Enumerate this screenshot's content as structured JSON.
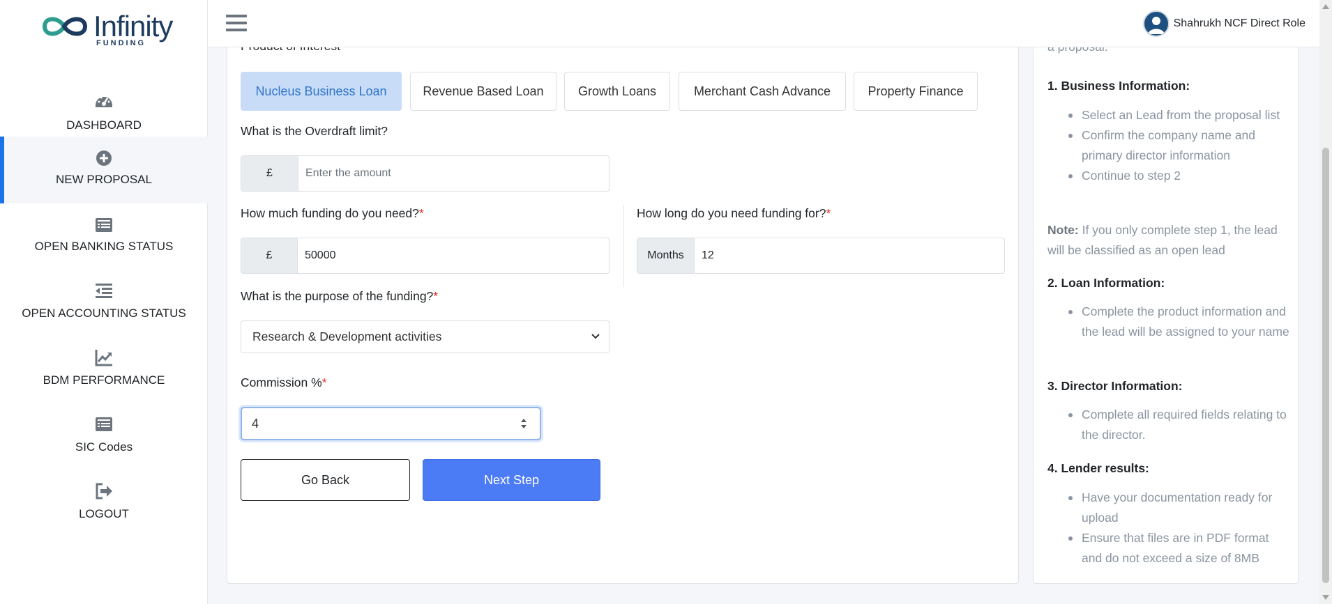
{
  "brand": {
    "name": "Infinity",
    "sub": "FUNDING"
  },
  "sidebar": {
    "items": [
      {
        "label": "DASHBOARD",
        "icon": "dashboard-icon"
      },
      {
        "label": "NEW PROPOSAL",
        "icon": "plus-circle-icon",
        "active": true
      },
      {
        "label": "OPEN BANKING STATUS",
        "icon": "list-card-icon"
      },
      {
        "label": "OPEN ACCOUNTING STATUS",
        "icon": "indent-list-icon"
      },
      {
        "label": "BDM PERFORMANCE",
        "icon": "chart-line-icon"
      },
      {
        "label": "SIC Codes",
        "icon": "list-card-icon"
      },
      {
        "label": "LOGOUT",
        "icon": "logout-icon"
      }
    ]
  },
  "header": {
    "user_name": "Shahrukh NCF Direct Role"
  },
  "form": {
    "product_label": "Product of Interest",
    "products": [
      {
        "label": "Nucleus Business Loan",
        "active": true
      },
      {
        "label": "Revenue Based Loan"
      },
      {
        "label": "Growth Loans"
      },
      {
        "label": "Merchant Cash Advance"
      },
      {
        "label": "Property Finance"
      }
    ],
    "overdraft_label": "What is the Overdraft limit?",
    "overdraft_prefix": "£",
    "overdraft_placeholder": "Enter the amount",
    "funding_label": "How much funding do you need?",
    "funding_prefix": "£",
    "funding_value": "50000",
    "duration_label": "How long do you need funding for?",
    "duration_prefix": "Months",
    "duration_value": "12",
    "purpose_label": "What is the purpose of the funding?",
    "purpose_value": "Research & Development activities",
    "commission_label": "Commission %",
    "commission_value": "4",
    "required_mark": "*",
    "back_label": "Go Back",
    "next_label": "Next Step"
  },
  "help": {
    "intro": "a proposal.",
    "sections": [
      {
        "title": "1. Business Information:",
        "items": [
          "Select an Lead from the proposal list",
          "Confirm the company name and primary director information",
          "Continue to step 2"
        ]
      },
      {
        "title": "2. Loan Information:",
        "items": [
          "Complete the product information and the lead will be assigned to your name"
        ]
      },
      {
        "title": "3. Director Information:",
        "items": [
          "Complete all required fields relating to the director."
        ]
      },
      {
        "title": "4. Lender results:",
        "items": [
          "Have your documentation ready for upload",
          "Ensure that files are in PDF format and do not exceed a size of 8MB"
        ]
      }
    ],
    "note_label": "Note:",
    "note_text": " If you only complete step 1, the lead will be classified as an open lead"
  },
  "colors": {
    "accent": "#4b7bf5",
    "active_tab": "#c9dcf7",
    "active_bar": "#1a73e8",
    "brand": "#1d3b5e"
  }
}
